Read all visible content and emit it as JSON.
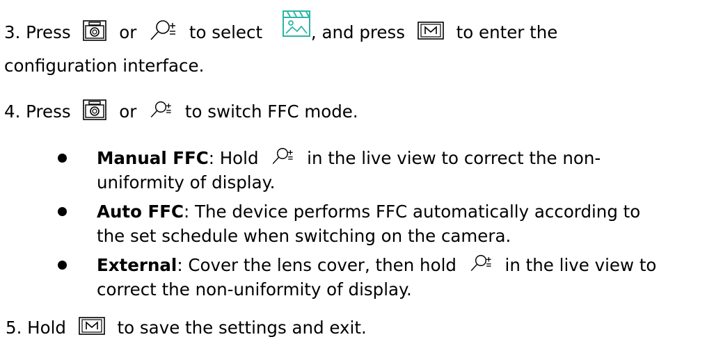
{
  "icons": {
    "camera": "camera-icon",
    "zoom": "zoom-icon",
    "menu": "menu-m-icon",
    "image_settings": "image-settings-icon",
    "accent_color": "#2bb5a6"
  },
  "step3": {
    "a": "3. Press",
    "b": "or",
    "c": "to select",
    "d": ", and press",
    "e": "to enter the",
    "f": "configuration interface."
  },
  "step4": {
    "a": "4. Press",
    "b": "or",
    "c": "to switch FFC mode."
  },
  "bullets": [
    {
      "term": "Manual FFC",
      "l1a": ": Hold",
      "l1b": "in the live view to correct the non-",
      "l2": "uniformity of display."
    },
    {
      "term": "Auto FFC",
      "l1a": ": The device performs FFC automatically according to",
      "l2": "the set schedule when switching on the camera."
    },
    {
      "term": "External",
      "l1a": ": Cover the lens cover, then hold",
      "l1b": "in the live view to",
      "l2": "correct the non-uniformity of display."
    }
  ],
  "step5": {
    "a": "5. Hold",
    "b": "to save the settings and exit."
  }
}
